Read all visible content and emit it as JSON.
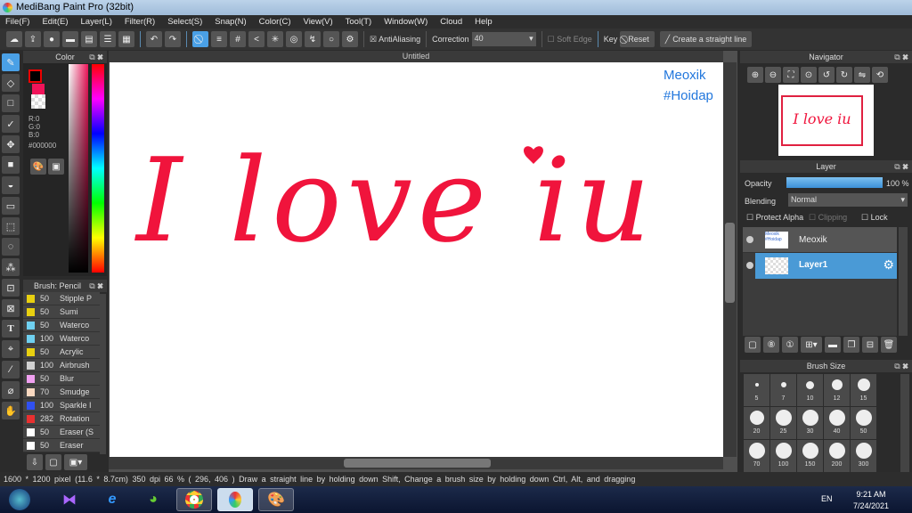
{
  "window": {
    "title": "MediBang Paint Pro (32bit)"
  },
  "menu": [
    "File(F)",
    "Edit(E)",
    "Layer(L)",
    "Filter(R)",
    "Select(S)",
    "Snap(N)",
    "Color(C)",
    "View(V)",
    "Tool(T)",
    "Window(W)",
    "Cloud",
    "Help"
  ],
  "toolbar": {
    "antialiasing_label": "AntiAliasing",
    "antialiasing_checked": true,
    "correction_label": "Correction",
    "correction_value": "40",
    "soft_edge_label": "Soft Edge",
    "soft_edge_checked": false,
    "key_label": "Key",
    "reset_label": "Reset",
    "straight_line_label": "Create a straight line"
  },
  "color_panel": {
    "title": "Color",
    "r": "R:0",
    "g": "G:0",
    "b": "B:0",
    "hex": "#000000",
    "primary": "#000000",
    "secondary": "#f0145a"
  },
  "brush_panel": {
    "title": "Brush: Pencil",
    "items": [
      {
        "size": "50",
        "name": "Stipple P",
        "color": "#e8d010"
      },
      {
        "size": "50",
        "name": "Sumi",
        "color": "#e8d010"
      },
      {
        "size": "50",
        "name": "Waterco",
        "color": "#6fd0f0"
      },
      {
        "size": "100",
        "name": "Waterco",
        "color": "#6fd0f0"
      },
      {
        "size": "50",
        "name": "Acrylic",
        "color": "#e8d010"
      },
      {
        "size": "100",
        "name": "Airbrush",
        "color": "#d0d0d0"
      },
      {
        "size": "50",
        "name": "Blur",
        "color": "#f0a0f0"
      },
      {
        "size": "70",
        "name": "Smudge",
        "color": "#f8d8c0"
      },
      {
        "size": "100",
        "name": "Sparkle I",
        "color": "#3050f0"
      },
      {
        "size": "282",
        "name": "Rotation",
        "color": "#e83030"
      },
      {
        "size": "50",
        "name": "Eraser (S",
        "color": "#ffffff"
      },
      {
        "size": "50",
        "name": "Eraser",
        "color": "#ffffff"
      }
    ]
  },
  "document": {
    "tab": "Untitled",
    "artwork_text": "I love iu",
    "watermark_line1": "Meoxik",
    "watermark_line2": "#Hoidap"
  },
  "navigator": {
    "title": "Navigator"
  },
  "layer_panel": {
    "title": "Layer",
    "opacity_label": "Opacity",
    "opacity_value": "100 %",
    "opacity": 100,
    "blending_label": "Blending",
    "blending_value": "Normal",
    "protect_alpha": "Protect Alpha",
    "clipping": "Clipping",
    "lock": "Lock",
    "layers": [
      {
        "name": "Meoxik",
        "selected": false
      },
      {
        "name": "Layer1",
        "selected": true
      }
    ]
  },
  "brush_size_panel": {
    "title": "Brush Size",
    "sizes": [
      "5",
      "7",
      "10",
      "12",
      "15",
      "20",
      "25",
      "30",
      "40",
      "50",
      "70",
      "100",
      "150",
      "200",
      "300"
    ]
  },
  "status": {
    "dimensions": "1600 * 1200 pixel",
    "physical": "(11.6 * 8.7cm)",
    "dpi": "350 dpi",
    "zoom": "66 %",
    "coords": "( 296, 406 )",
    "hint": "Draw a straight line by holding down Shift, Change a brush size by holding down Ctrl, Alt, and dragging"
  },
  "taskbar": {
    "lang": "EN",
    "time": "9:21 AM",
    "date": "7/24/2021"
  }
}
